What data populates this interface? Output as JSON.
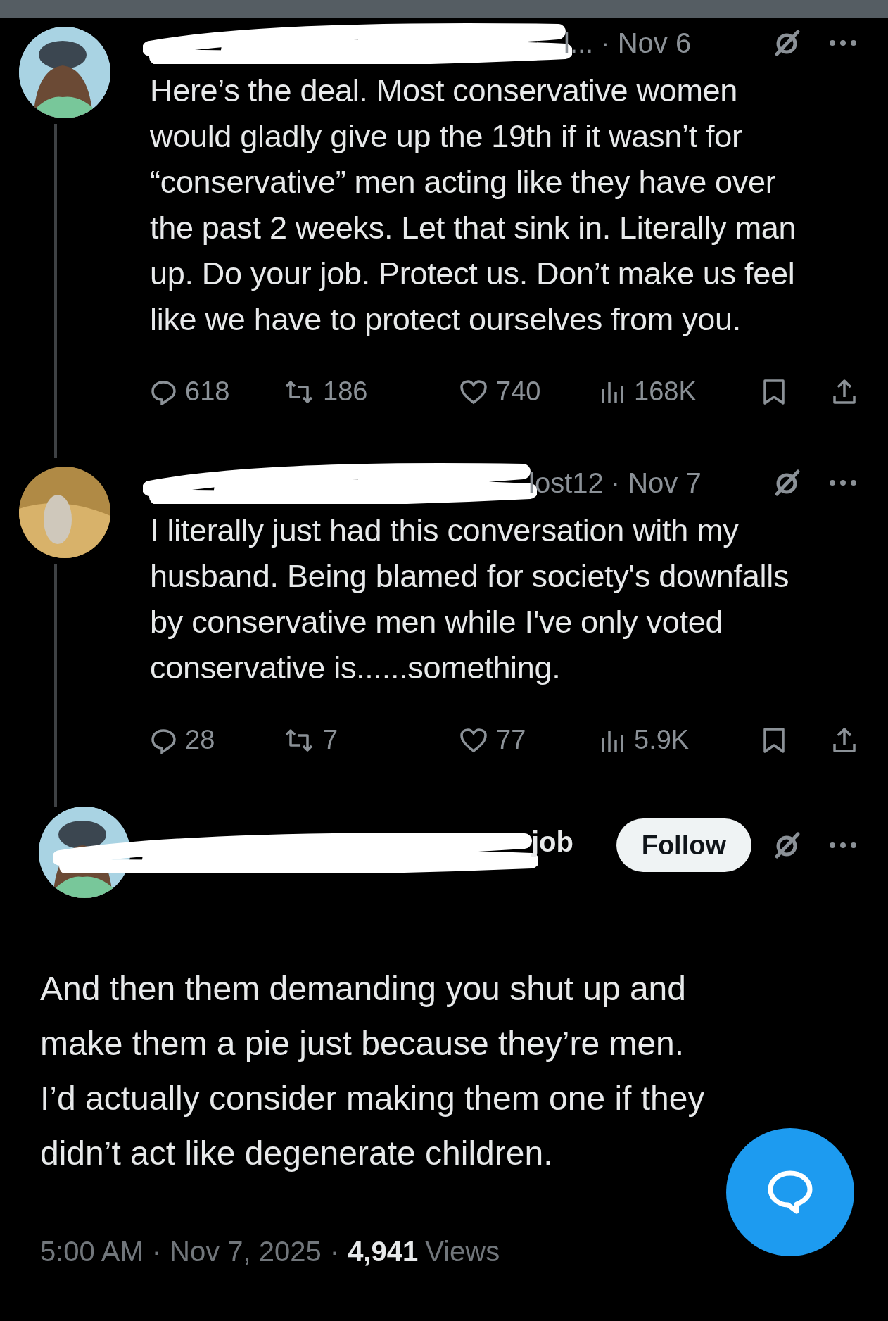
{
  "thread": [
    {
      "name_fragment": "l...",
      "date": "· Nov 6",
      "text": "Here’s the deal. Most conservative women would gladly give up the 19th if it wasn’t for “conservative” men acting like they have over the past 2 weeks. Let that sink in. Literally man up. Do your job. Protect us. Don’t make us feel like we have to protect ourselves from you.",
      "stats": {
        "replies": "618",
        "reposts": "186",
        "likes": "740",
        "views": "168K"
      }
    },
    {
      "name_fragment": "lost12",
      "date": "· Nov 7",
      "text": "I literally just had this conversation with my husband. Being blamed for society's downfalls by conservative men while I've only voted conservative is......something.",
      "stats": {
        "replies": "28",
        "reposts": "7",
        "likes": "77",
        "views": "5.9K"
      }
    }
  ],
  "main_post": {
    "name_fragment": "job",
    "follow_button": "Follow",
    "text": "And then them demanding you shut up and make them a pie just because they’re men. I’d actually consider making them one if they didn’t act like degenerate children.",
    "time": "5:00 AM",
    "sep_1": "·",
    "date": "Nov 7, 2025",
    "sep_2": "·",
    "views_count": "4,941",
    "views_label": "Views"
  }
}
